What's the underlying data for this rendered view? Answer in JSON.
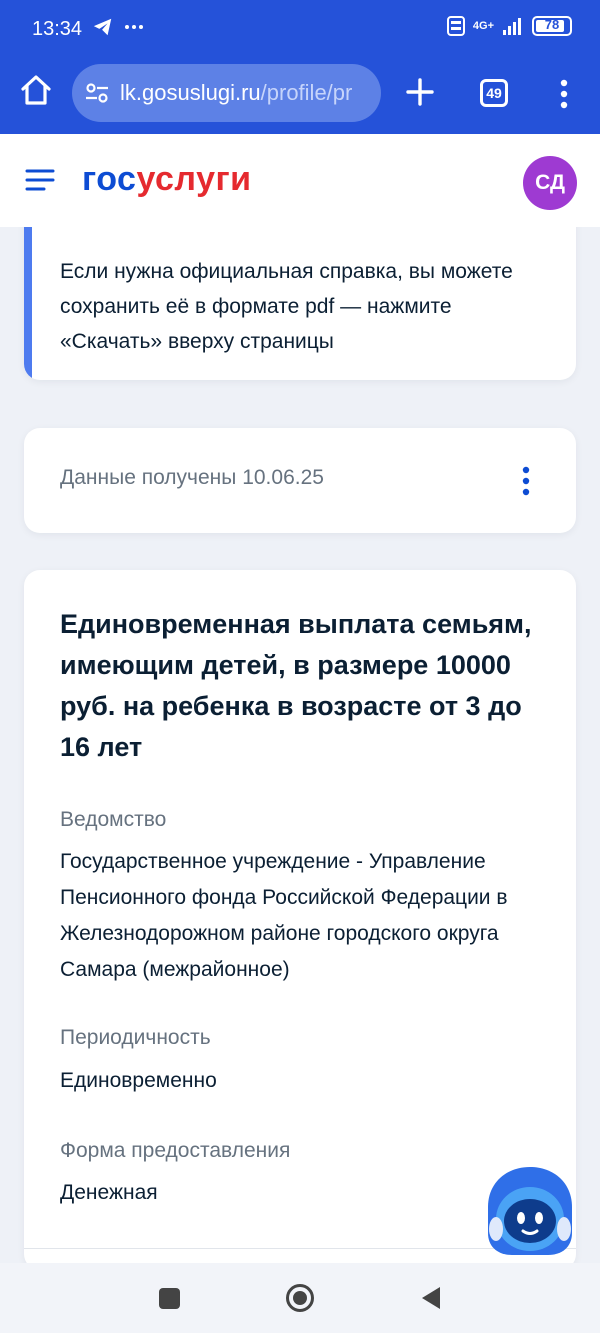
{
  "status_bar": {
    "time": "13:34",
    "battery": "78",
    "network": "4G+"
  },
  "browser": {
    "url_host": "lk.gosuslugi.ru",
    "url_path": "/profile/pr",
    "tab_count": "49"
  },
  "header": {
    "logo_part1": "гос",
    "logo_part2": "услуги",
    "avatar_initials": "СД"
  },
  "info_card": {
    "text": "Если нужна официальная справка, вы можете сохранить её в формате pdf — нажмите «Скачать» вверху страницы"
  },
  "date_card": {
    "text": "Данные получены 10.06.25"
  },
  "main_card": {
    "title": "Единовременная выплата семьям, имеющим детей, в размере 10000 руб. на ребенка в возрасте от 3 до 16 лет",
    "fields": [
      {
        "label": "Ведомство",
        "value": "Государственное учреждение - Управление Пенсионного фонда Российской Федерации в Железнодорожном районе городского округа Самара (межрайонное)"
      },
      {
        "label": "Периодичность",
        "value": "Единовременно"
      },
      {
        "label": "Форма предоставления",
        "value": "Денежная"
      }
    ]
  },
  "colors": {
    "browser_bar": "#2552d9",
    "logo_blue": "#0d4cd3",
    "logo_red": "#e52a2f",
    "avatar": "#9e3ad2",
    "accent": "#4e7bef"
  }
}
